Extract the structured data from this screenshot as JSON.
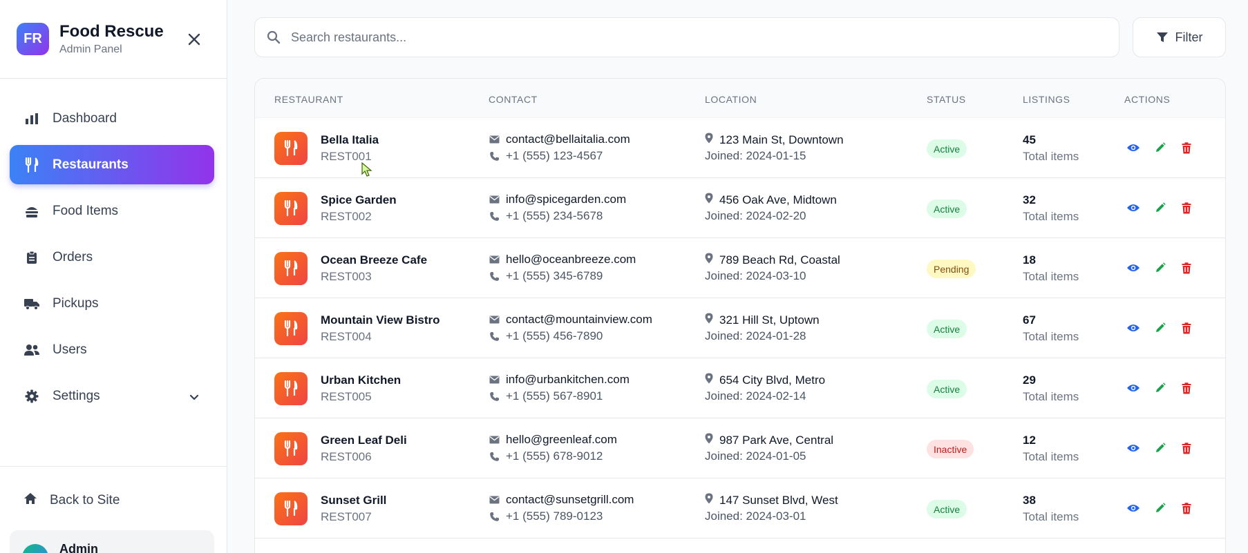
{
  "brand": {
    "logo_text": "FR",
    "title": "Food Rescue",
    "subtitle": "Admin Panel"
  },
  "nav": [
    {
      "label": "Dashboard",
      "icon": "chart-bar-icon",
      "active": false
    },
    {
      "label": "Restaurants",
      "icon": "utensils-icon",
      "active": true
    },
    {
      "label": "Food Items",
      "icon": "hamburger-icon",
      "active": false
    },
    {
      "label": "Orders",
      "icon": "clipboard-icon",
      "active": false
    },
    {
      "label": "Pickups",
      "icon": "truck-icon",
      "active": false
    },
    {
      "label": "Users",
      "icon": "users-icon",
      "active": false
    },
    {
      "label": "Settings",
      "icon": "gear-icon",
      "active": false,
      "has_submenu": true
    }
  ],
  "back_to_site": {
    "label": "Back to Site",
    "icon": "home-icon"
  },
  "admin": {
    "name": "Admin"
  },
  "search": {
    "placeholder": "Search restaurants..."
  },
  "filter": {
    "label": "Filter"
  },
  "table": {
    "headers": {
      "restaurant": "RESTAURANT",
      "contact": "CONTACT",
      "location": "LOCATION",
      "status": "STATUS",
      "listings": "LISTINGS",
      "actions": "ACTIONS"
    },
    "rows": [
      {
        "name": "Bella Italia",
        "code": "REST001",
        "email": "contact@bellaitalia.com",
        "phone": "+1 (555) 123-4567",
        "address": "123 Main St, Downtown",
        "joined": "Joined: 2024-01-15",
        "status": "Active",
        "status_type": "active",
        "count": "45",
        "count_label": "Total items"
      },
      {
        "name": "Spice Garden",
        "code": "REST002",
        "email": "info@spicegarden.com",
        "phone": "+1 (555) 234-5678",
        "address": "456 Oak Ave, Midtown",
        "joined": "Joined: 2024-02-20",
        "status": "Active",
        "status_type": "active",
        "count": "32",
        "count_label": "Total items"
      },
      {
        "name": "Ocean Breeze Cafe",
        "code": "REST003",
        "email": "hello@oceanbreeze.com",
        "phone": "+1 (555) 345-6789",
        "address": "789 Beach Rd, Coastal",
        "joined": "Joined: 2024-03-10",
        "status": "Pending",
        "status_type": "pending",
        "count": "18",
        "count_label": "Total items"
      },
      {
        "name": "Mountain View Bistro",
        "code": "REST004",
        "email": "contact@mountainview.com",
        "phone": "+1 (555) 456-7890",
        "address": "321 Hill St, Uptown",
        "joined": "Joined: 2024-01-28",
        "status": "Active",
        "status_type": "active",
        "count": "67",
        "count_label": "Total items"
      },
      {
        "name": "Urban Kitchen",
        "code": "REST005",
        "email": "info@urbankitchen.com",
        "phone": "+1 (555) 567-8901",
        "address": "654 City Blvd, Metro",
        "joined": "Joined: 2024-02-14",
        "status": "Active",
        "status_type": "active",
        "count": "29",
        "count_label": "Total items"
      },
      {
        "name": "Green Leaf Deli",
        "code": "REST006",
        "email": "hello@greenleaf.com",
        "phone": "+1 (555) 678-9012",
        "address": "987 Park Ave, Central",
        "joined": "Joined: 2024-01-05",
        "status": "Inactive",
        "status_type": "inactive",
        "count": "12",
        "count_label": "Total items"
      },
      {
        "name": "Sunset Grill",
        "code": "REST007",
        "email": "contact@sunsetgrill.com",
        "phone": "+1 (555) 789-0123",
        "address": "147 Sunset Blvd, West",
        "joined": "Joined: 2024-03-01",
        "status": "Active",
        "status_type": "active",
        "count": "38",
        "count_label": "Total items"
      }
    ]
  },
  "colors": {
    "accent_gradient_start": "#3b82f6",
    "accent_gradient_end": "#9333ea",
    "restaurant_icon_start": "#f97316",
    "restaurant_icon_end": "#ef4444",
    "view_icon": "#2563eb",
    "edit_icon": "#16a34a",
    "delete_icon": "#dc2626"
  }
}
